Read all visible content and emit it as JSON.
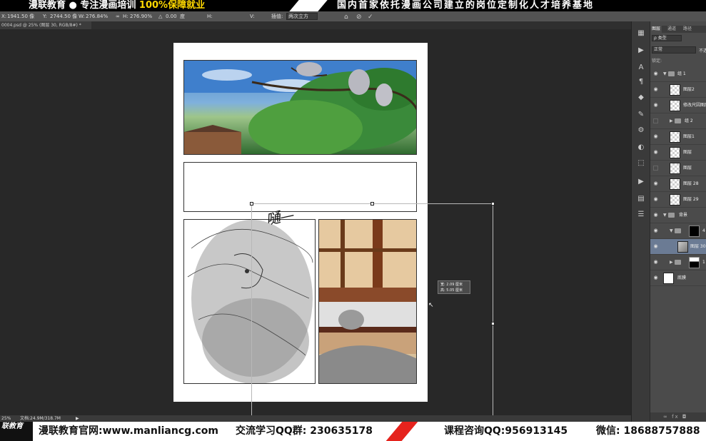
{
  "top_banner": {
    "left_text_a": "漫联教育 ● 专注漫画培训 ",
    "left_text_b": "100%保障就业",
    "right_text": "国内首家依托漫画公司建立的岗位定制化人才培养基地"
  },
  "options_bar": {
    "x_value": "1941.50 像",
    "y_value": "2744.50 像",
    "w_label": "W:",
    "w_value": "276.84%",
    "h_label": "H:",
    "h_value": "276.90%",
    "angle_value": "0.00",
    "angle_unit": "度",
    "interp_label": "插值:",
    "interp_value": "两次立方"
  },
  "document": {
    "tab_label": "0004.psd @ 25% (图层 30, RGB/8#) *",
    "zoom": "25%",
    "doc_size": "文档:24.9M/318.7M"
  },
  "canvas": {
    "sfx_text": "嗵—",
    "tooltip_width": "宽: 2.09 厘米",
    "tooltip_height": "高: 5.05 厘米",
    "handle_count": 6
  },
  "layers_panel": {
    "tabs": [
      "图层",
      "通道",
      "路径"
    ],
    "filter": "类型",
    "blend_mode": "正常",
    "opacity_label": "不透",
    "lock_label": "锁定:",
    "layers": [
      {
        "name": "组 1",
        "kind": "group",
        "indent": 1,
        "expanded": true,
        "visible": true
      },
      {
        "name": "图层2",
        "kind": "layer",
        "indent": 2,
        "visible": true
      },
      {
        "name": "修改尺因图层",
        "kind": "layer",
        "indent": 2,
        "visible": true
      },
      {
        "name": "组 2",
        "kind": "group",
        "indent": 2,
        "expanded": false,
        "visible": false
      },
      {
        "name": "图层1",
        "kind": "layer",
        "indent": 2,
        "visible": true
      },
      {
        "name": "图层",
        "kind": "layer",
        "indent": 2,
        "visible": true
      },
      {
        "name": "图层",
        "kind": "layer",
        "indent": 2,
        "visible": false
      },
      {
        "name": "图层 28",
        "kind": "layer",
        "indent": 2,
        "visible": true
      },
      {
        "name": "图层 29",
        "kind": "layer",
        "indent": 2,
        "visible": true
      },
      {
        "name": "背景",
        "kind": "group",
        "indent": 1,
        "expanded": true,
        "visible": true
      },
      {
        "name": "4",
        "kind": "group-mask",
        "indent": 2,
        "expanded": true,
        "visible": true
      },
      {
        "name": "图层 30",
        "kind": "layer-img",
        "indent": 3,
        "visible": true,
        "selected": true
      },
      {
        "name": "1",
        "kind": "group-mask",
        "indent": 2,
        "expanded": false,
        "visible": true
      },
      {
        "name": "底膜",
        "kind": "layer-white",
        "indent": 1,
        "visible": true
      }
    ]
  },
  "bottom_banner": {
    "logo_text": "联教育",
    "site": "漫联教育官网:www.manliancg.com",
    "qq_group": "交流学习QQ群: 230635178",
    "consult": "课程咨询QQ:956913145",
    "wechat": "微信: 18688757888"
  }
}
